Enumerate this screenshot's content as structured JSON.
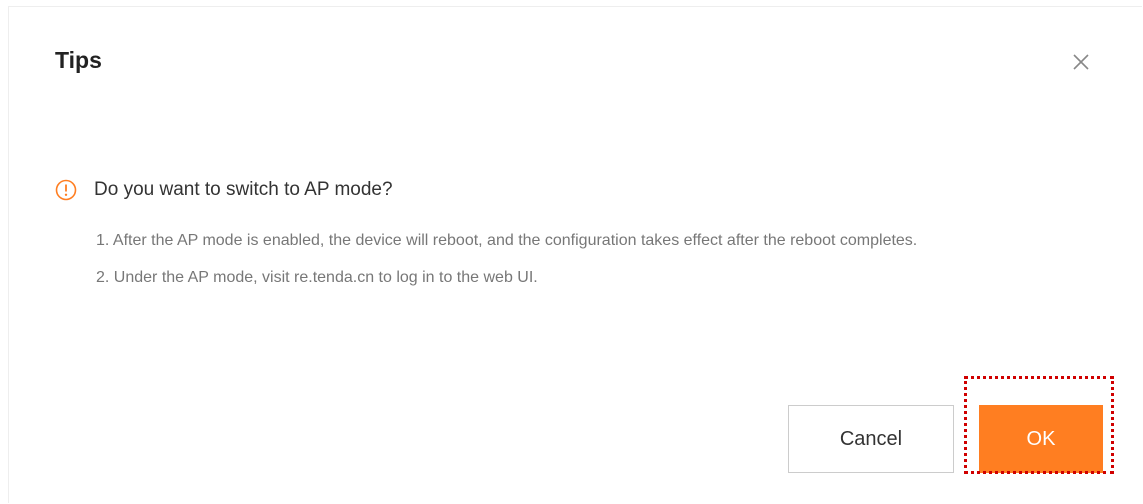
{
  "dialog": {
    "title": "Tips",
    "close_icon": "close-icon",
    "warning_icon": "exclamation-circle-icon",
    "question": "Do you want to switch to AP mode?",
    "notes": [
      "1. After the AP mode is enabled, the device will reboot, and the configuration takes effect after the reboot completes.",
      "2. Under the AP mode, visit re.tenda.cn to log in to the web UI."
    ],
    "cancel_label": "Cancel",
    "ok_label": "OK"
  },
  "colors": {
    "accent": "#ff7e21",
    "highlight_border": "#d00000",
    "question_text": "#333333",
    "notes_text": "#777777"
  }
}
